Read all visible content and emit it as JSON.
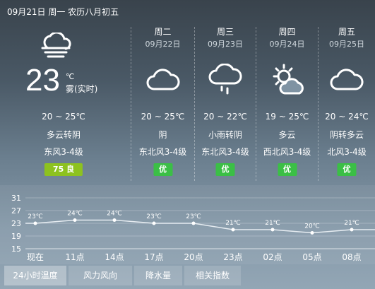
{
  "header": {
    "date_line": "09月21日 周一 农历八月初五"
  },
  "today": {
    "icon": "cloudy-fog-icon",
    "temp": "23",
    "unit": "℃",
    "desc": "雾(实时)",
    "range": "20 ~ 25℃",
    "condition": "多云转阴",
    "wind": "东风3-4级",
    "aqi": "75 良"
  },
  "forecast": [
    {
      "weekday": "周二",
      "date": "09月22日",
      "icon": "cloud-icon",
      "range": "20 ~ 25℃",
      "condition": "阴",
      "wind": "东北风3-4级",
      "aqi": "优"
    },
    {
      "weekday": "周三",
      "date": "09月23日",
      "icon": "light-rain-icon",
      "range": "20 ~ 22℃",
      "condition": "小雨转阴",
      "wind": "东北风3-4级",
      "aqi": "优"
    },
    {
      "weekday": "周四",
      "date": "09月24日",
      "icon": "partly-cloudy-icon",
      "range": "19 ~ 25℃",
      "condition": "多云",
      "wind": "西北风3-4级",
      "aqi": "优"
    },
    {
      "weekday": "周五",
      "date": "09月25日",
      "icon": "cloud-icon",
      "range": "20 ~ 24℃",
      "condition": "阴转多云",
      "wind": "北风3-4级",
      "aqi": "优"
    }
  ],
  "chart_data": {
    "type": "line",
    "categories": [
      "现在",
      "11点",
      "14点",
      "17点",
      "20点",
      "23点",
      "02点",
      "05点",
      "08点"
    ],
    "series": [
      {
        "values": [
          23,
          24,
          24,
          23,
          23,
          21,
          21,
          20,
          21
        ]
      }
    ],
    "data_labels": [
      "23℃",
      "24℃",
      "24℃",
      "23℃",
      "23℃",
      "21℃",
      "21℃",
      "20℃",
      "21℃"
    ],
    "y_ticks": [
      "31",
      "27",
      "23",
      "19",
      "15"
    ],
    "ylim": [
      15,
      31
    ],
    "grid": true
  },
  "tabs": [
    {
      "label": "24小时温度",
      "active": true
    },
    {
      "label": "风力风向",
      "active": false
    },
    {
      "label": "降水量",
      "active": false
    },
    {
      "label": "相关指数",
      "active": false
    }
  ],
  "colors": {
    "aqi_good": "#8dc21f",
    "aqi_excellent": "#3bbf46"
  }
}
